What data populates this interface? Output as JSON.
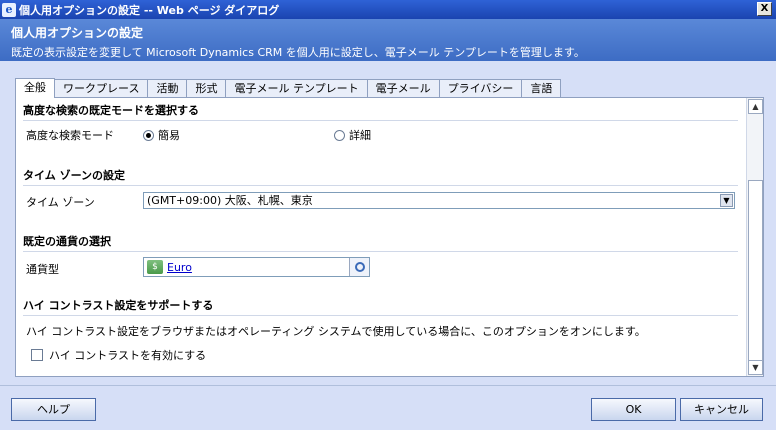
{
  "window": {
    "title": "個人用オプションの設定 -- Web ページ ダイアログ",
    "close_label": "X"
  },
  "header": {
    "title": "個人用オプションの設定",
    "description": "既定の表示設定を変更して Microsoft Dynamics CRM を個人用に設定し、電子メール テンプレートを管理します。"
  },
  "tabs": [
    {
      "label": "全般",
      "active": true
    },
    {
      "label": "ワークプレース"
    },
    {
      "label": "活動"
    },
    {
      "label": "形式"
    },
    {
      "label": "電子メール テンプレート"
    },
    {
      "label": "電子メール"
    },
    {
      "label": "プライバシー"
    },
    {
      "label": "言語"
    }
  ],
  "sections": {
    "search": {
      "title": "高度な検索の既定モードを選択する",
      "label": "高度な検索モード",
      "option_simple": "簡易",
      "option_detailed": "詳細",
      "selected": "簡易"
    },
    "timezone": {
      "title": "タイム ゾーンの設定",
      "label": "タイム ゾーン",
      "value": "(GMT+09:00) 大阪、札幌、東京"
    },
    "currency": {
      "title": "既定の通貨の選択",
      "label": "通貨型",
      "value": "Euro"
    },
    "contrast": {
      "title": "ハイ コントラスト設定をサポートする",
      "description": "ハイ コントラスト設定をブラウザまたはオペレーティング システムで使用している場合に、このオプションをオンにします。",
      "checkbox_label": "ハイ コントラストを有効にする",
      "checked": false
    }
  },
  "footer": {
    "help": "ヘルプ",
    "ok": "OK",
    "cancel": "キャンセル"
  }
}
